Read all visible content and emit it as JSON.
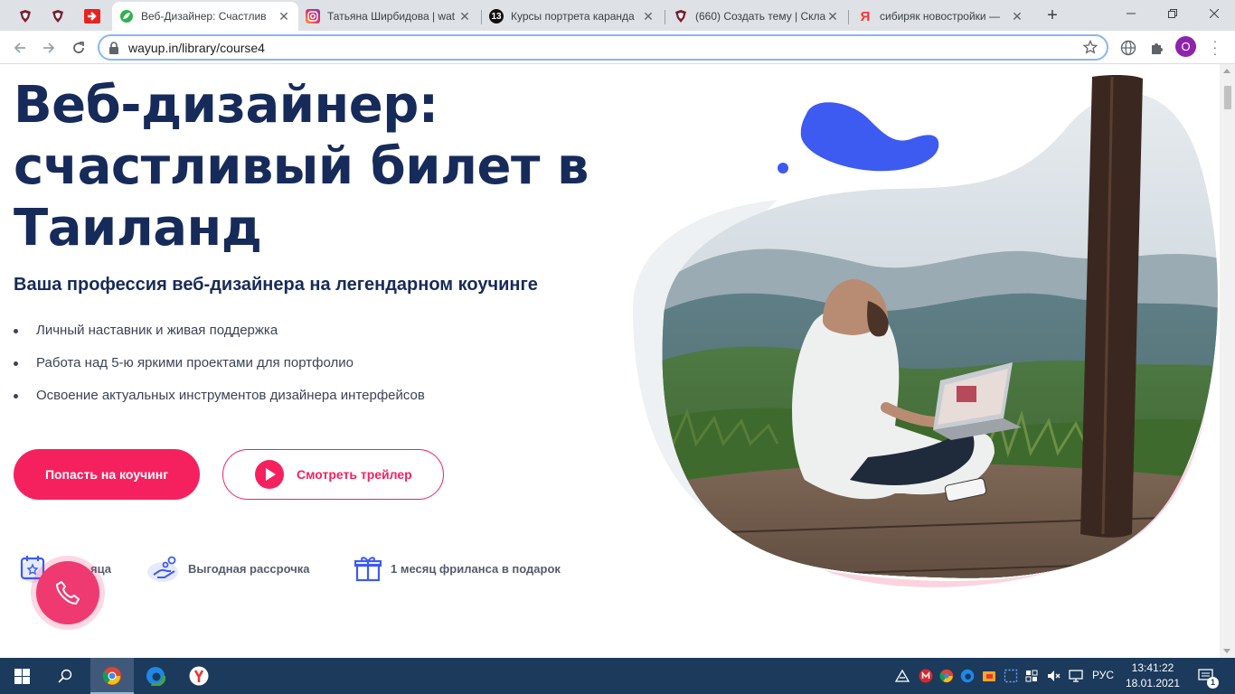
{
  "browser": {
    "tabs": [
      {
        "title": "Веб-Дизайнер: Счастлив",
        "active": true
      },
      {
        "title": "Татьяна Ширбидова | wat",
        "active": false
      },
      {
        "title": "Курсы портрета каранда",
        "active": false
      },
      {
        "title": "(660) Создать тему | Скла",
        "active": false
      },
      {
        "title": "сибиряк новостройки —",
        "active": false
      }
    ],
    "tab_badge_13": "13",
    "url": "wayup.in/library/course4",
    "profile_initial": "O"
  },
  "hero": {
    "title_lines": [
      "Веб-дизайнер:",
      "счастливый билет в",
      "Таиланд"
    ],
    "subtitle": "Ваша профессия веб-дизайнера на легендарном коучинге",
    "features": [
      "Личный наставник и живая поддержка",
      "Работа над 5-ю яркими проектами для портфолио",
      "Освоение актуальных инструментов дизайнера интерфейсов"
    ],
    "primary_button": "Попасть на коучинг",
    "trailer_button": "Смотреть трейлер",
    "perks": [
      {
        "label": "яца",
        "icon": "calendar-icon"
      },
      {
        "label": "Выгодная рассрочка",
        "icon": "hand-coins-icon"
      },
      {
        "label": "1 месяц фриланса в подарок",
        "icon": "gift-icon"
      }
    ]
  },
  "taskbar": {
    "language": "РУС",
    "time": "13:41:22",
    "date": "18.01.2021",
    "notification_count": "1"
  },
  "colors": {
    "accent": "#f5215f",
    "heading": "#172b5a",
    "blob_blue": "#3d5af1",
    "blob_pink": "#fbd3df",
    "taskbar": "#1b3a5c"
  }
}
